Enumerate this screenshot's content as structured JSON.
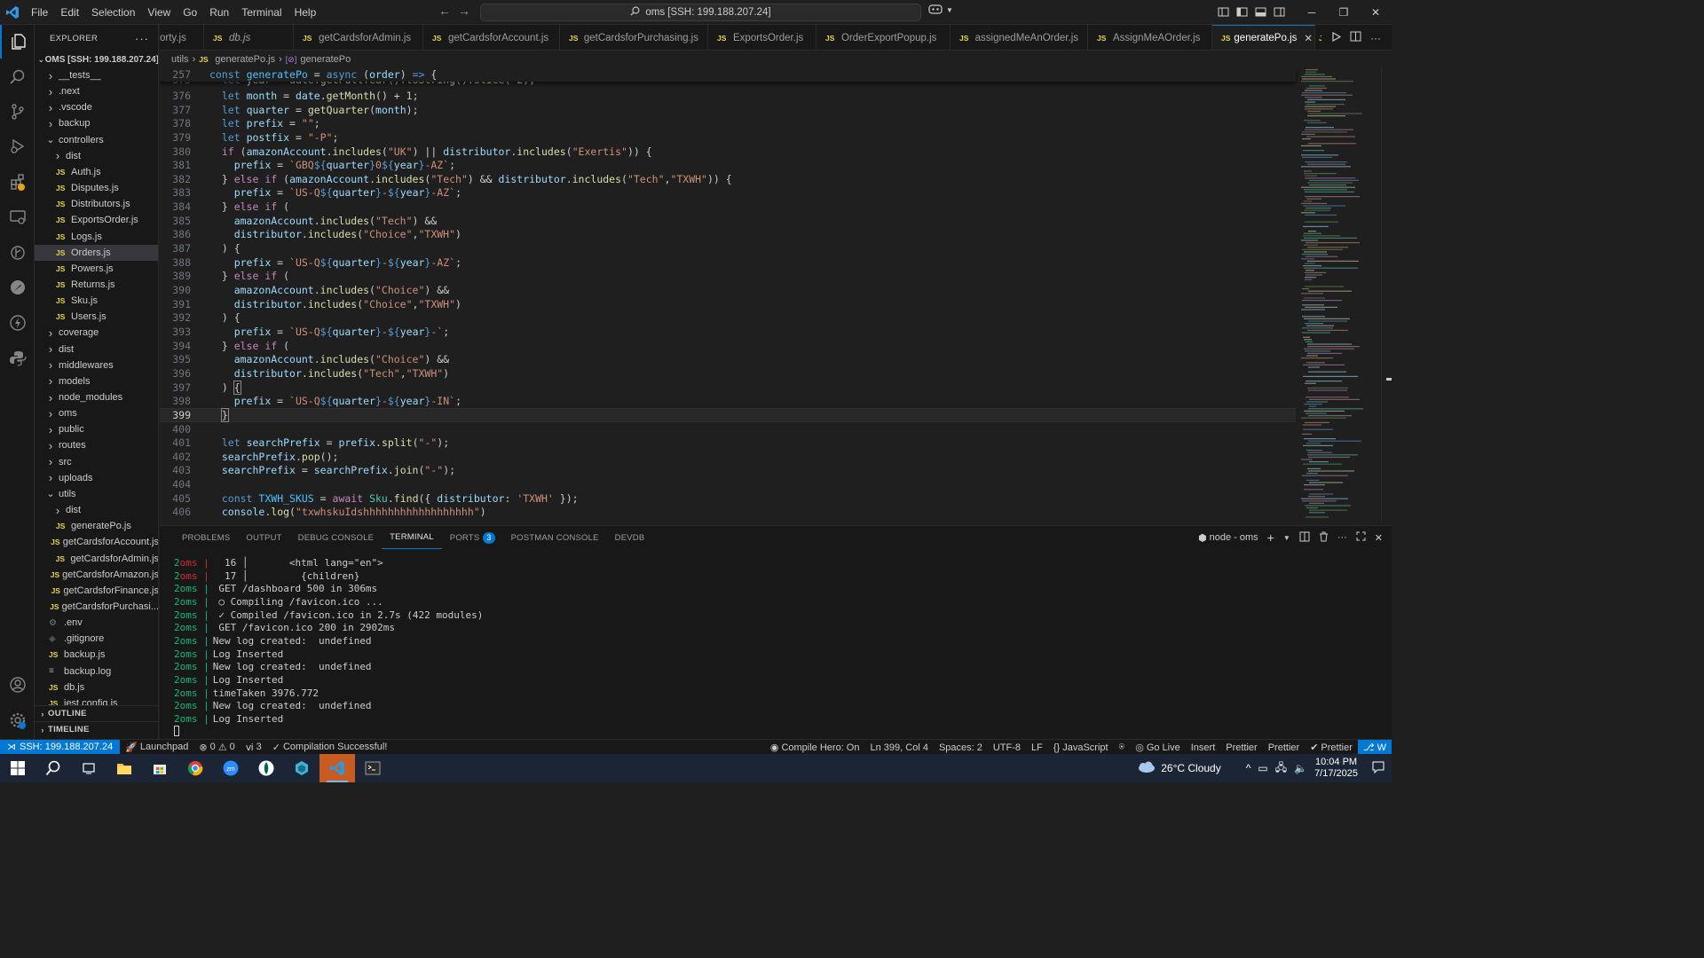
{
  "menu": [
    "File",
    "Edit",
    "Selection",
    "View",
    "Go",
    "Run",
    "Terminal",
    "Help"
  ],
  "command_center": "oms [SSH: 199.188.207.24]",
  "explorer": {
    "title": "EXPLORER",
    "root": "OMS [SSH: 199.188.207.24]",
    "items": [
      {
        "label": "__tests__",
        "type": "folder",
        "open": false,
        "depth": 1
      },
      {
        "label": ".next",
        "type": "folder",
        "open": false,
        "depth": 1
      },
      {
        "label": ".vscode",
        "type": "folder",
        "open": false,
        "depth": 1
      },
      {
        "label": "backup",
        "type": "folder",
        "open": false,
        "depth": 1
      },
      {
        "label": "controllers",
        "type": "folder",
        "open": true,
        "depth": 1
      },
      {
        "label": "dist",
        "type": "folder",
        "open": false,
        "depth": 2
      },
      {
        "label": "Auth.js",
        "type": "js",
        "depth": 2
      },
      {
        "label": "Disputes.js",
        "type": "js",
        "depth": 2
      },
      {
        "label": "Distributors.js",
        "type": "js",
        "depth": 2
      },
      {
        "label": "ExportsOrder.js",
        "type": "js",
        "depth": 2
      },
      {
        "label": "Logs.js",
        "type": "js",
        "depth": 2
      },
      {
        "label": "Orders.js",
        "type": "js",
        "depth": 2,
        "selected": true
      },
      {
        "label": "Powers.js",
        "type": "js",
        "depth": 2
      },
      {
        "label": "Returns.js",
        "type": "js",
        "depth": 2
      },
      {
        "label": "Sku.js",
        "type": "js",
        "depth": 2
      },
      {
        "label": "Users.js",
        "type": "js",
        "depth": 2
      },
      {
        "label": "coverage",
        "type": "folder",
        "open": false,
        "depth": 1
      },
      {
        "label": "dist",
        "type": "folder",
        "open": false,
        "depth": 1
      },
      {
        "label": "middlewares",
        "type": "folder",
        "open": false,
        "depth": 1
      },
      {
        "label": "models",
        "type": "folder",
        "open": false,
        "depth": 1
      },
      {
        "label": "node_modules",
        "type": "folder",
        "open": false,
        "depth": 1
      },
      {
        "label": "oms",
        "type": "folder",
        "open": false,
        "depth": 1
      },
      {
        "label": "public",
        "type": "folder",
        "open": false,
        "depth": 1
      },
      {
        "label": "routes",
        "type": "folder",
        "open": false,
        "depth": 1
      },
      {
        "label": "src",
        "type": "folder",
        "open": false,
        "depth": 1
      },
      {
        "label": "uploads",
        "type": "folder",
        "open": false,
        "depth": 1
      },
      {
        "label": "utils",
        "type": "folder",
        "open": true,
        "depth": 1
      },
      {
        "label": "dist",
        "type": "folder",
        "open": false,
        "depth": 2
      },
      {
        "label": "generatePo.js",
        "type": "js",
        "depth": 2
      },
      {
        "label": "getCardsforAccount.js",
        "type": "js",
        "depth": 2
      },
      {
        "label": "getCardsforAdmin.js",
        "type": "js",
        "depth": 2
      },
      {
        "label": "getCardsforAmazon.js",
        "type": "js",
        "depth": 2
      },
      {
        "label": "getCardsforFinance.js",
        "type": "js",
        "depth": 2
      },
      {
        "label": "getCardsforPurchasi...",
        "type": "js",
        "depth": 2
      },
      {
        "label": ".env",
        "type": "gear",
        "depth": 1
      },
      {
        "label": ".gitignore",
        "type": "git",
        "depth": 1
      },
      {
        "label": "backup.js",
        "type": "js",
        "depth": 1
      },
      {
        "label": "backup.log",
        "type": "log",
        "depth": 1
      },
      {
        "label": "db.js",
        "type": "js",
        "depth": 1
      },
      {
        "label": "jest.config.js",
        "type": "js",
        "depth": 1
      }
    ],
    "outline": "OUTLINE",
    "timeline": "TIMELINE"
  },
  "tabs": [
    {
      "label": "orty.js",
      "active": false
    },
    {
      "label": "db.js",
      "active": false,
      "italic": true
    },
    {
      "label": "getCardsforAdmin.js",
      "active": false
    },
    {
      "label": "getCardsforAccount.js",
      "active": false
    },
    {
      "label": "getCardsforPurchasing.js",
      "active": false
    },
    {
      "label": "ExportsOrder.js",
      "active": false
    },
    {
      "label": "OrderExportPopup.js",
      "active": false
    },
    {
      "label": "assignedMeAnOrder.js",
      "active": false
    },
    {
      "label": "AssignMeAOrder.js",
      "active": false
    },
    {
      "label": "generatePo.js",
      "active": true
    }
  ],
  "breadcrumb": [
    "utils",
    "generatePo.js",
    "generatePo"
  ],
  "code": {
    "sticky_line_number": "257",
    "current_line": "399",
    "line_numbers": [
      "375",
      "376",
      "377",
      "378",
      "379",
      "380",
      "381",
      "382",
      "383",
      "384",
      "385",
      "386",
      "387",
      "388",
      "389",
      "390",
      "391",
      "392",
      "393",
      "394",
      "395",
      "396",
      "397",
      "398",
      "399",
      "400",
      "401",
      "402",
      "403",
      "404",
      "405",
      "406"
    ]
  },
  "panel": {
    "tabs": [
      "PROBLEMS",
      "OUTPUT",
      "DEBUG CONSOLE",
      "TERMINAL",
      "PORTS",
      "POSTMAN CONSOLE",
      "DEVDB"
    ],
    "active_tab": "TERMINAL",
    "ports_count": "3",
    "terminal_name": "node - oms",
    "terminal_lines": [
      {
        "n": "2",
        "name": "oms",
        "sep": "|",
        "red": true,
        "text": "  16 │       <html lang=\"en\">"
      },
      {
        "n": "2",
        "name": "oms",
        "sep": "|",
        "red": true,
        "text": "  17 │         {children}"
      },
      {
        "n": "2",
        "name": "oms",
        "sep": "|",
        "red": false,
        "text": " GET /dashboard 500 in 306ms"
      },
      {
        "n": "2",
        "name": "oms",
        "sep": "|",
        "red": false,
        "text": " ○ Compiling /favicon.ico ..."
      },
      {
        "n": "2",
        "name": "oms",
        "sep": "|",
        "red": false,
        "text": " ✓ Compiled /favicon.ico in 2.7s (422 modules)"
      },
      {
        "n": "2",
        "name": "oms",
        "sep": "|",
        "red": false,
        "text": " GET /favicon.ico 200 in 2902ms"
      },
      {
        "n": "2",
        "name": "oms",
        "sep": "|",
        "red": false,
        "text": "New log created:  undefined"
      },
      {
        "n": "2",
        "name": "oms",
        "sep": "|",
        "red": false,
        "text": "Log Inserted"
      },
      {
        "n": "2",
        "name": "oms",
        "sep": "|",
        "red": false,
        "text": "New log created:  undefined"
      },
      {
        "n": "2",
        "name": "oms",
        "sep": "|",
        "red": false,
        "text": "Log Inserted"
      },
      {
        "n": "2",
        "name": "oms",
        "sep": "|",
        "red": false,
        "text": "timeTaken 3976.772"
      },
      {
        "n": "2",
        "name": "oms",
        "sep": "|",
        "red": false,
        "text": "New log created:  undefined"
      },
      {
        "n": "2",
        "name": "oms",
        "sep": "|",
        "red": false,
        "text": "Log Inserted"
      }
    ]
  },
  "statusbar": {
    "remote": "SSH: 199.188.207.24",
    "launchpad": "Launchpad",
    "errors": "0",
    "warnings": "0",
    "ports": "3",
    "compilation": "Compilation Successful!",
    "compile_hero": "Compile Hero: On",
    "position": "Ln 399, Col 4",
    "spaces": "Spaces: 2",
    "encoding": "UTF-8",
    "eol": "LF",
    "language": "JavaScript",
    "go_live": "Go Live",
    "insert": "Insert",
    "prettier1": "Prettier",
    "prettier2": "Prettier",
    "prettier3": "Prettier"
  },
  "taskbar": {
    "weather": "26°C  Cloudy",
    "time": "10:04 PM",
    "date": "7/17/2025"
  },
  "colors": {
    "accent": "#0078d4",
    "js": "#e8d44d"
  }
}
